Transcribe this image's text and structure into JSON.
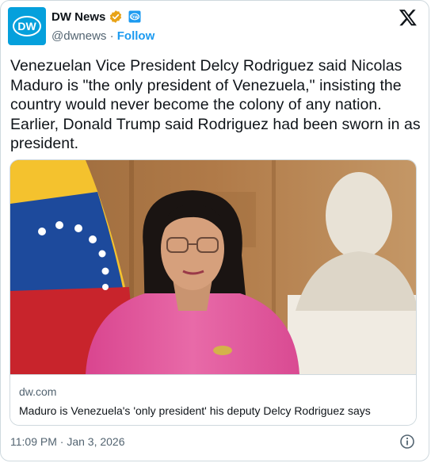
{
  "author": {
    "name": "DW News",
    "handle": "@dwnews",
    "separator": "·",
    "follow_label": "Follow",
    "avatar_text": "DW",
    "brand_color": "#05a0dc",
    "verified_color": "#e8a317",
    "affiliate_color": "#1d9bf0"
  },
  "tweet": {
    "text": "Venezuelan Vice President Delcy Rodriguez said Nicolas Maduro is \"the only president of Venezuela,\" insisting the country would never become the colony of any nation. Earlier, Donald Trump said Rodriguez had been sworn in as president."
  },
  "link_card": {
    "domain": "dw.com",
    "headline": "Maduro is Venezuela's 'only president' his deputy Delcy Rodriguez says"
  },
  "timestamp": "11:09 PM · Jan 3, 2026",
  "icons": {
    "platform": "x-logo-icon",
    "verified": "verified-badge-icon",
    "affiliate": "affiliate-badge-icon",
    "info": "info-icon"
  },
  "colors": {
    "text": "#0f1419",
    "muted": "#536471",
    "border": "#cfd9de",
    "accent": "#1d9bf0",
    "shirt_pink": "#e0569c"
  }
}
